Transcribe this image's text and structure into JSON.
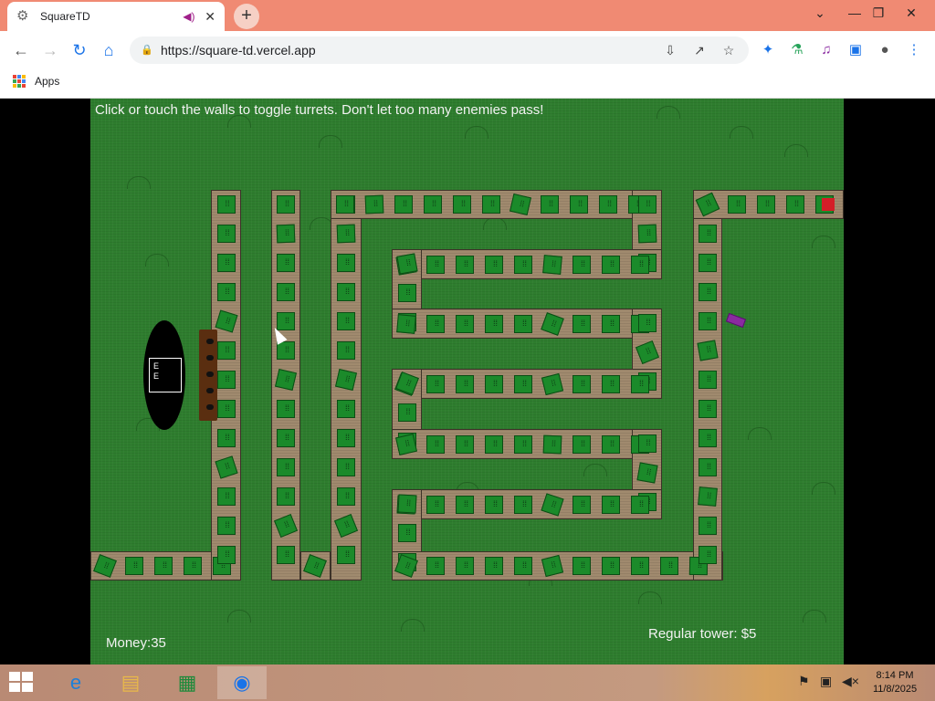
{
  "browser": {
    "tab_title": "SquareTD",
    "url": "https://square-td.vercel.app",
    "bookmarks_apps_label": "Apps"
  },
  "game": {
    "instructions": "Click or touch the walls to toggle turrets. Don't let too many enemies pass!",
    "money_text": "Money:35",
    "tower_price_text": "Regular tower: $5"
  },
  "taskbar": {
    "time": "8:14 PM",
    "date": "11/8/2025"
  },
  "colors": {
    "grass": "#2e7d2e",
    "wall": "#a08a6e",
    "turret": "#1b8a2a",
    "goal": "#d41e28",
    "enemy": "#8a2aa0",
    "tab_bar": "#f08a73"
  }
}
